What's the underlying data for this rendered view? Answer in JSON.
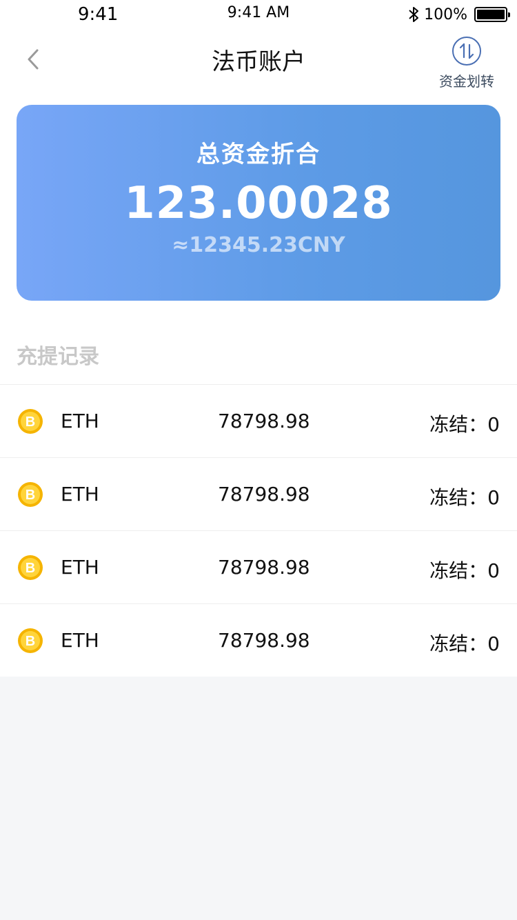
{
  "status_bar": {
    "time_left": "9:41",
    "time_center": "9:41 AM",
    "battery_percent": "100%",
    "bluetooth_icon": "bluetooth-icon",
    "battery_icon": "battery-icon"
  },
  "nav": {
    "title": "法币账户",
    "back_icon": "chevron-left-icon",
    "transfer_icon": "transfer-arrows-icon",
    "transfer_label": "资金划转"
  },
  "asset_card": {
    "label": "总资金折合",
    "amount": "123.00028",
    "equivalent": "≈12345.23CNY",
    "gradient_start": "#78a6f7",
    "gradient_end": "#5596de"
  },
  "section_title": "充提记录",
  "records": [
    {
      "icon": "coin-b-icon",
      "name": "ETH",
      "amount": "78798.98",
      "frozen": "冻结：0"
    },
    {
      "icon": "coin-b-icon",
      "name": "ETH",
      "amount": "78798.98",
      "frozen": "冻结：0"
    },
    {
      "icon": "coin-b-icon",
      "name": "ETH",
      "amount": "78798.98",
      "frozen": "冻结：0"
    },
    {
      "icon": "coin-b-icon",
      "name": "ETH",
      "amount": "78798.98",
      "frozen": "冻结：0"
    }
  ],
  "colors": {
    "coin": "#f5b400",
    "accent_icon": "#4a6fb3",
    "background": "#f5f6f8"
  }
}
